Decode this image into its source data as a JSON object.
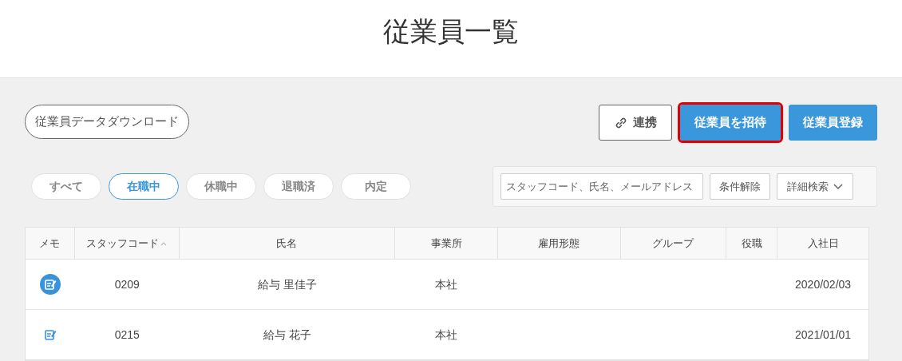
{
  "page_title": "従業員一覧",
  "download_button": "従業員データダウンロード",
  "actions": [
    {
      "label": "連携",
      "kind": "link",
      "highlighted": false
    },
    {
      "label": "従業員を招待",
      "kind": "primary",
      "highlighted": true
    },
    {
      "label": "従業員登録",
      "kind": "primary",
      "highlighted": false
    }
  ],
  "status_tabs": [
    {
      "label": "すべて",
      "selected": false
    },
    {
      "label": "在職中",
      "selected": true
    },
    {
      "label": "休職中",
      "selected": false
    },
    {
      "label": "退職済",
      "selected": false
    },
    {
      "label": "内定",
      "selected": false
    }
  ],
  "search": {
    "placeholder": "スタッフコード、氏名、メールアドレス",
    "clear_button": "条件解除",
    "advanced_button": "詳細検索"
  },
  "table": {
    "columns": [
      {
        "label": "メモ",
        "sorted": false
      },
      {
        "label": "スタッフコード",
        "sorted": true
      },
      {
        "label": "氏名",
        "sorted": false
      },
      {
        "label": "事業所",
        "sorted": false
      },
      {
        "label": "雇用形態",
        "sorted": false
      },
      {
        "label": "グループ",
        "sorted": false
      },
      {
        "label": "役職",
        "sorted": false
      },
      {
        "label": "入社日",
        "sorted": false
      }
    ],
    "rows": [
      {
        "has_memo": true,
        "code": "0209",
        "name": "給与 里佳子",
        "office": "本社",
        "hire_date": "2020/02/03"
      },
      {
        "has_memo": false,
        "code": "0215",
        "name": "給与 花子",
        "office": "本社",
        "hire_date": "2021/01/01"
      }
    ]
  }
}
